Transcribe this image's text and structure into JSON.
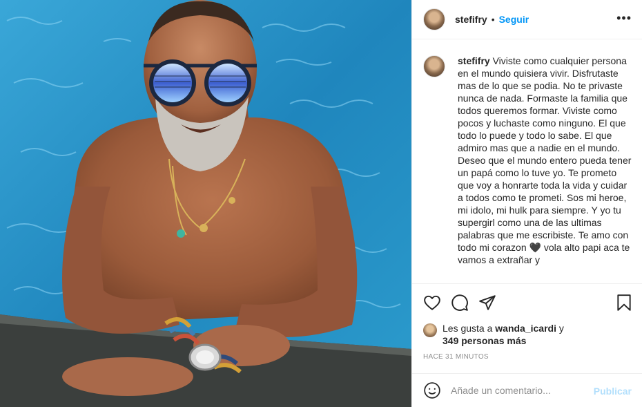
{
  "post": {
    "username": "stefifry",
    "separator": "•",
    "follow_label": "Seguir",
    "more_label": "•••",
    "caption_user": "stefifry",
    "caption_text": " Viviste como cualquier persona en el mundo quisiera vivir. Disfrutaste mas de lo que se podia. No te privaste nunca de nada. Formaste la familia que todos queremos formar. Viviste como pocos y luchaste como ninguno. El que todo lo puede y todo lo sabe. El que admiro mas que a nadie en el mundo.\nDeseo que el mundo entero pueda tener un papá como lo tuve yo. Te prometo que voy a honrarte toda la vida y cuidar a todos como te prometi. Sos mi heroe, mi idolo, mi hulk para siempre. Y yo tu supergirl como una de las ultimas palabras que me escribiste. Te amo con todo mi corazon 🖤 vola alto papi aca te vamos a extrañar y",
    "likes_prefix": "Les gusta a ",
    "likes_user": "wanda_icardi",
    "likes_mid": " y",
    "likes_count": "349 personas más",
    "timestamp": "HACE 31 MINUTOS",
    "comment_placeholder": "Añade un comentario...",
    "publish_label": "Publicar"
  },
  "icons": {
    "like": "heart-icon",
    "comment": "comment-icon",
    "share": "share-icon",
    "save": "bookmark-icon",
    "emoji": "emoji-icon"
  },
  "colors": {
    "accent": "#0095f6",
    "publish_disabled": "#b2dffc",
    "text": "#262626",
    "muted": "#8e8e8e"
  }
}
